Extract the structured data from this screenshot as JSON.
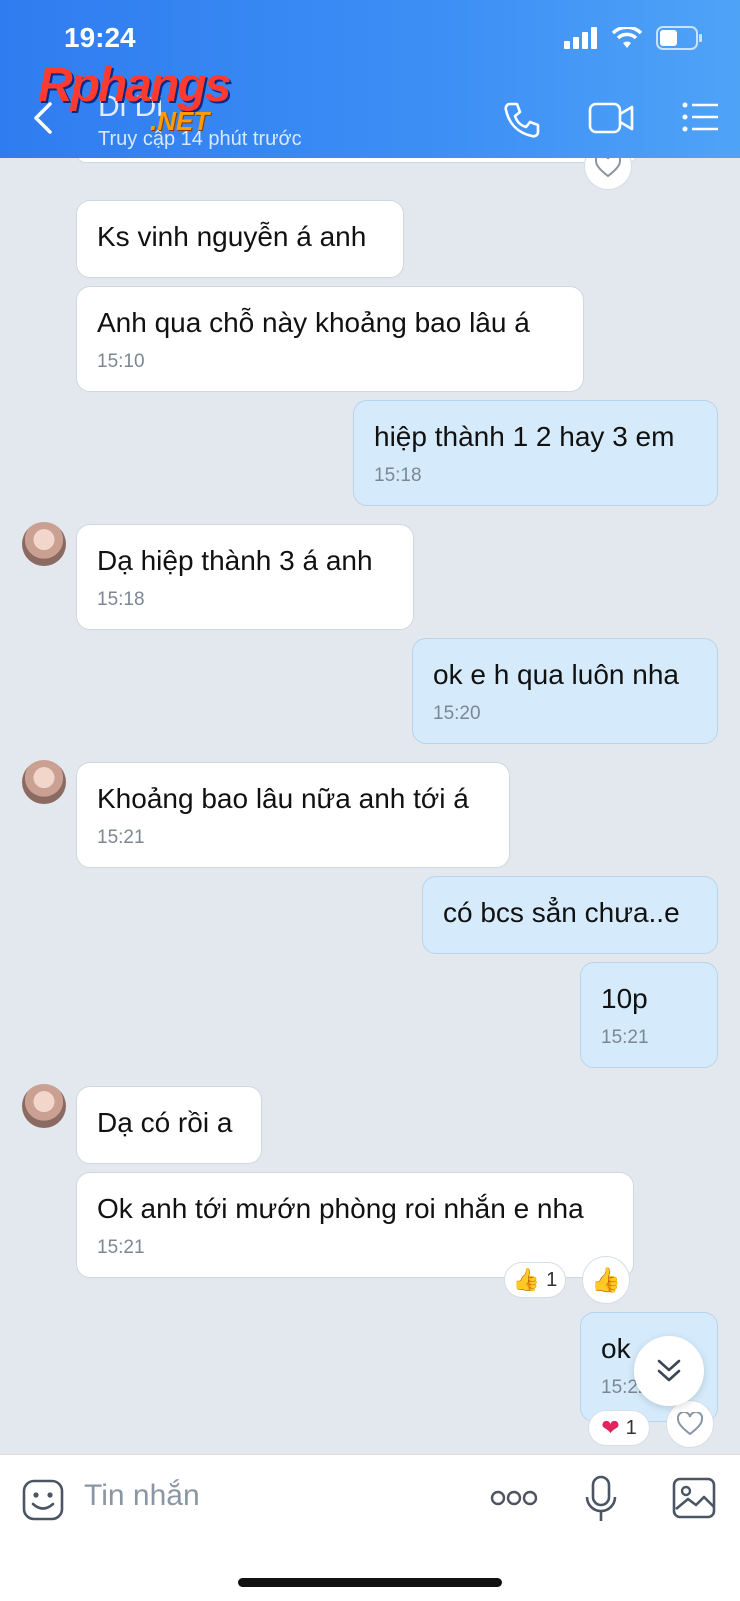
{
  "status_bar": {
    "time": "19:24"
  },
  "watermark": {
    "text_main": "Rphangs",
    "text_sub": ".NET"
  },
  "header": {
    "title": "Di Di",
    "subtitle": "Truy cập 14 phút trước"
  },
  "messages": [
    {
      "dir": "in",
      "text": "Ks vinh nguyễn á anh",
      "time": ""
    },
    {
      "dir": "in",
      "text": "Anh qua chỗ này khoảng bao lâu á",
      "time": "15:10"
    },
    {
      "dir": "out",
      "text": "hiệp thành 1 2 hay 3 em",
      "time": "15:18"
    },
    {
      "dir": "in",
      "text": "Dạ hiệp thành 3 á anh",
      "time": "15:18"
    },
    {
      "dir": "out",
      "text": "ok e h qua luôn nha",
      "time": "15:20"
    },
    {
      "dir": "in",
      "text": "Khoảng bao lâu nữa anh tới á",
      "time": "15:21"
    },
    {
      "dir": "out",
      "text": "có bcs sẳn chưa..e",
      "time": ""
    },
    {
      "dir": "out",
      "text": "10p",
      "time": "15:21"
    },
    {
      "dir": "in",
      "text": "Dạ có rồi a",
      "time": ""
    },
    {
      "dir": "in",
      "text": "Ok anh tới mướn phòng roi nhắn e nha",
      "time": "15:21"
    },
    {
      "dir": "out",
      "text": "ok",
      "time": "15:22"
    }
  ],
  "reactions": {
    "thumbs_count": "1",
    "heart_count": "1"
  },
  "composer": {
    "placeholder": "Tin nhắn"
  }
}
